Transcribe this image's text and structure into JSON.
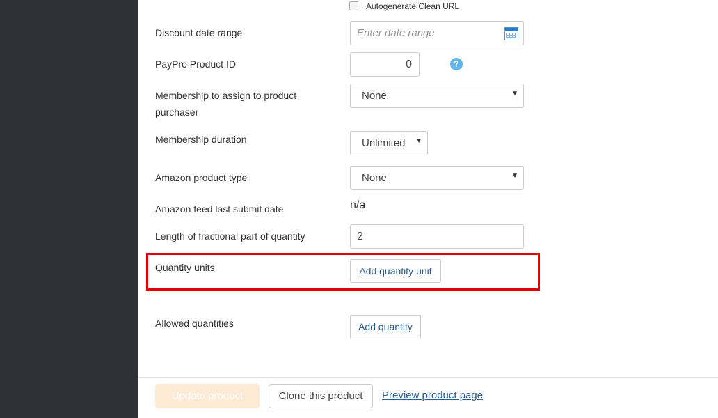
{
  "form": {
    "autogenerate_clean_url": {
      "label": "Autogenerate Clean URL",
      "checked": false
    },
    "discount_date_range": {
      "label": "Discount date range",
      "placeholder": "Enter date range"
    },
    "paypro_product_id": {
      "label": "PayPro Product ID",
      "value": "0"
    },
    "membership_assign": {
      "label_line1": "Membership to assign to product",
      "label_line2": "purchaser",
      "value": "None"
    },
    "membership_duration": {
      "label": "Membership duration",
      "value": "Unlimited"
    },
    "amazon_product_type": {
      "label": "Amazon product type",
      "value": "None"
    },
    "amazon_feed_last_submit": {
      "label": "Amazon feed last submit date",
      "value": "n/a"
    },
    "fractional_length": {
      "label": "Length of fractional part of quantity",
      "value": "2"
    },
    "quantity_units": {
      "label": "Quantity units",
      "button": "Add quantity unit"
    },
    "allowed_quantities": {
      "label": "Allowed quantities",
      "button": "Add quantity"
    }
  },
  "footer": {
    "update_button": "Update product",
    "clone_button": "Clone this product",
    "preview_link": "Preview product page"
  },
  "icons": {
    "help": "?",
    "dropdown_arrow": "▼"
  },
  "colors": {
    "sidebar_bg": "#303038",
    "highlight_border": "#e30000",
    "link": "#2a5b8a",
    "help_icon": "#5fb4e8",
    "update_button_bg": "#fdebd6"
  }
}
